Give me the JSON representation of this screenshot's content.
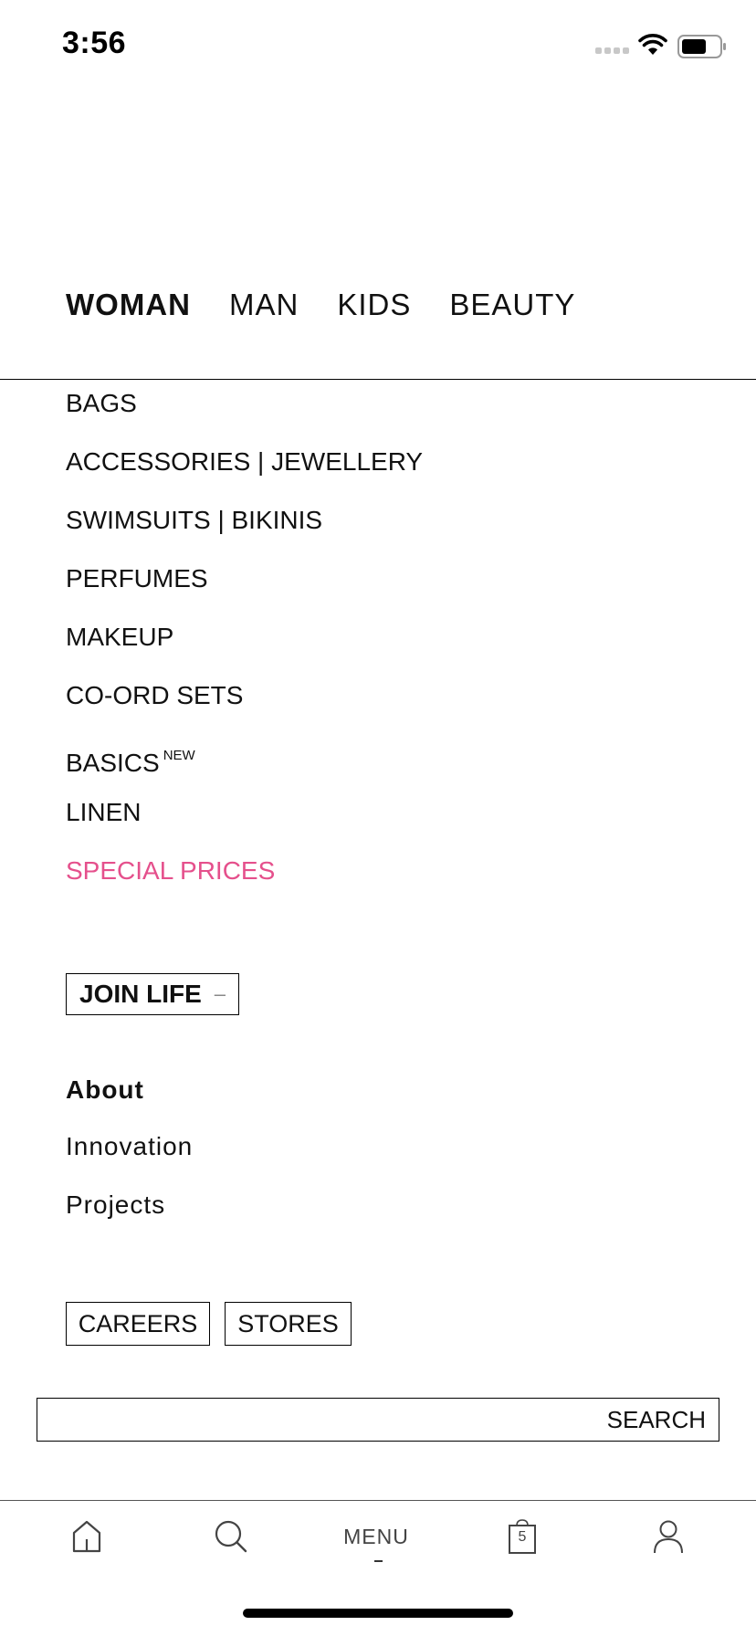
{
  "status_bar": {
    "time": "3:56"
  },
  "categories": [
    {
      "label": "WOMAN",
      "active": true
    },
    {
      "label": "MAN"
    },
    {
      "label": "KIDS"
    },
    {
      "label": "BEAUTY"
    }
  ],
  "menu": {
    "items": [
      "BAGS",
      "ACCESSORIES | JEWELLERY",
      "SWIMSUITS | BIKINIS",
      "PERFUMES",
      "MAKEUP",
      "CO-ORD SETS",
      "BASICS",
      "LINEN",
      "SPECIAL PRICES"
    ],
    "basics_badge": "NEW",
    "special_color": "#e5508c"
  },
  "join_life": {
    "label": "JOIN LIFE",
    "toggle": "–"
  },
  "about": {
    "heading": "About",
    "links": [
      "Innovation",
      "Projects"
    ]
  },
  "buttons": {
    "careers": "CAREERS",
    "stores": "STORES"
  },
  "search": {
    "label": "SEARCH"
  },
  "tabbar": {
    "menu_label": "MENU",
    "bag_count": "5",
    "icons": [
      "home-icon",
      "search-icon",
      "bag-icon",
      "account-icon"
    ]
  }
}
